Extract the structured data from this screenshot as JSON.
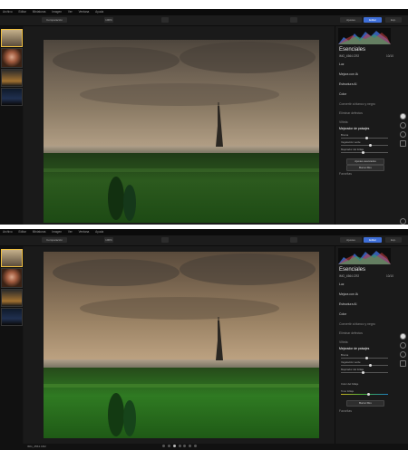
{
  "menu": [
    "Archivo",
    "Editar",
    "Miniaturas",
    "Imagen",
    "Ver",
    "Ventana",
    "Ayuda"
  ],
  "toolbar": {
    "comparison_label": "Comparación",
    "zoom_label": "100%",
    "presets_label": "Ajustes",
    "edit_label": "Editar",
    "export_label": "Exp."
  },
  "panel": {
    "title": "Esenciales",
    "filename": "IMG_4564.CR2",
    "counter": "10/10",
    "sections": {
      "luz": "Luz",
      "mejora_ia": "Mejora con IA",
      "estructura_ia": "Estructura AI",
      "color": "Color",
      "convertir_bn": "Convertir a blanco y negro",
      "eliminar_defectos": "Eliminar defectos",
      "mejorador_paisajes": "Mejorador de paisajes",
      "viñeta": "Viñeta",
      "favoritas": "Favoritas"
    },
    "slider_labels": [
      "Bruma",
      "Vegetación verde",
      "Mejorador del follaje"
    ],
    "slider_values": [
      0.55,
      0.62,
      0.48
    ],
    "slider_values_bottom": [
      0.55,
      0.62,
      0.48,
      0.58
    ],
    "extra_slider_label": "Tono follaje",
    "popover_label": "Color del follaje",
    "buttons": {
      "ajustes_avanzados": "Ajustes avanzados",
      "restablecer": "Borrar filtro"
    }
  },
  "status": {
    "filename": "IMG_4564.CR2"
  },
  "colors": {
    "accent_blue": "#3f6fd8",
    "panel_bg": "#1a1a1a",
    "app_bg": "#161616"
  }
}
